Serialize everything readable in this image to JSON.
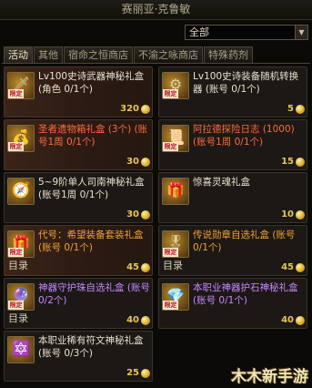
{
  "window": {
    "title": "赛丽亚·克鲁敏"
  },
  "filter": {
    "selected": "全部"
  },
  "tabs": [
    {
      "label": "活动",
      "active": true
    },
    {
      "label": "其他",
      "active": false
    },
    {
      "label": "宿命之恒商店",
      "active": false
    },
    {
      "label": "不渝之咏商店",
      "active": false
    },
    {
      "label": "特殊药剂",
      "active": false
    }
  ],
  "items": [
    {
      "name": "Lv100史诗武器神秘礼盒(角色 0/1个)",
      "price": "320",
      "tag": "限定",
      "icon": "chest-icon",
      "color": "white",
      "highlight": true,
      "dir": ""
    },
    {
      "name": "Lv100史诗装备随机转换器 (账号 0/1个)",
      "price": "5",
      "tag": "限定",
      "icon": "converter-icon",
      "color": "white",
      "highlight": false,
      "dir": ""
    },
    {
      "name": "圣者遗物箱礼盒 (3个) (账号1周 0/1个)",
      "price": "30",
      "tag": "限定",
      "icon": "treasure-icon",
      "color": "red",
      "highlight": true,
      "dir": ""
    },
    {
      "name": "阿拉德探险日志 (1000) (账号1周 0/1个)",
      "price": "15",
      "tag": "限定",
      "icon": "journal-icon",
      "color": "red",
      "highlight": false,
      "dir": ""
    },
    {
      "name": "5~9阶单人司南神秘礼盒 (账号1周 0/1个)",
      "price": "30",
      "tag": "",
      "icon": "compass-icon",
      "color": "white",
      "highlight": false,
      "dir": ""
    },
    {
      "name": "惊喜灵魂礼盒",
      "price": "10",
      "tag": "",
      "icon": "soul-box-icon",
      "color": "white",
      "highlight": false,
      "dir": ""
    },
    {
      "name": "代号：希望装备套装礼盒 (账号 0/1个)",
      "price": "45",
      "tag": "限定",
      "icon": "gift-box-icon",
      "color": "orange",
      "highlight": true,
      "dir": "目录"
    },
    {
      "name": "传说勋章自选礼盒 (账号 0/1个)",
      "price": "45",
      "tag": "限定",
      "icon": "medal-box-icon",
      "color": "orange",
      "highlight": false,
      "dir": "目录"
    },
    {
      "name": "神器守护珠自选礼盒 (账号 0/2个)",
      "price": "40",
      "tag": "限定",
      "icon": "orb-box-icon",
      "color": "purple",
      "highlight": false,
      "dir": "目录"
    },
    {
      "name": "本职业神器护石神秘礼盒 (账号 0/1个)",
      "price": "40",
      "tag": "限定",
      "icon": "stone-box-icon",
      "color": "purple",
      "highlight": false,
      "dir": ""
    },
    {
      "name": "本职业稀有符文神秘礼盒 (账号 0/3个)",
      "price": "25",
      "tag": "",
      "icon": "rune-box-icon",
      "color": "white",
      "highlight": false,
      "dir": ""
    }
  ],
  "watermark": "木木新手游"
}
